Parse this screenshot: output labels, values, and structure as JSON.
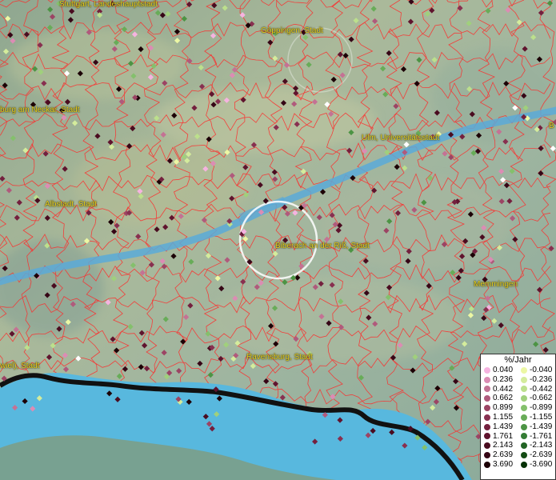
{
  "cities": [
    {
      "id": "stuttgart",
      "label": "Stuttgart, Landeshauptstadt"
    },
    {
      "id": "goeppingen",
      "label": "Göppingen, Stadt"
    },
    {
      "id": "neckar",
      "label": "burg am Neckar, Stadt"
    },
    {
      "id": "ulm",
      "label": "Ulm, Universitätsstadt"
    },
    {
      "id": "albstadt",
      "label": "Albstadt, Stadt"
    },
    {
      "id": "biberach",
      "label": "Biberach an der Riß, Stadt"
    },
    {
      "id": "memmingen",
      "label": "Memmingen"
    },
    {
      "id": "ravensburg",
      "label": "Ravensburg, Stadt"
    },
    {
      "id": "wiel",
      "label": "wiel), Stadt"
    },
    {
      "id": "edge_b",
      "label": "B"
    }
  ],
  "legend": {
    "title": "%/Jahr",
    "positive": {
      "values": [
        "0.040",
        "0.236",
        "0.442",
        "0.662",
        "0.899",
        "1.155",
        "1.439",
        "1.761",
        "2.143",
        "2.639",
        "3.690"
      ],
      "colors": [
        "#f6b3e0",
        "#dc8cb4",
        "#c47294",
        "#b05a7c",
        "#9c4464",
        "#883050",
        "#74203e",
        "#60142e",
        "#4a0c20",
        "#360616",
        "#1c0006"
      ]
    },
    "negative": {
      "values": [
        "-0.040",
        "-0.236",
        "-0.442",
        "-0.662",
        "-0.899",
        "-1.155",
        "-1.439",
        "-1.761",
        "-2.143",
        "-2.639",
        "-3.690"
      ],
      "colors": [
        "#ecf7a4",
        "#d4ec9c",
        "#bce08c",
        "#a0d07c",
        "#84c06c",
        "#68ac58",
        "#4c9444",
        "#347c34",
        "#226424",
        "#144c14",
        "#063206"
      ]
    }
  },
  "colors": {
    "lake": "#58b8de",
    "river": "#5aaad8",
    "borders": "#ff2a2a",
    "coast": "#111111",
    "label": "#e8d020"
  }
}
